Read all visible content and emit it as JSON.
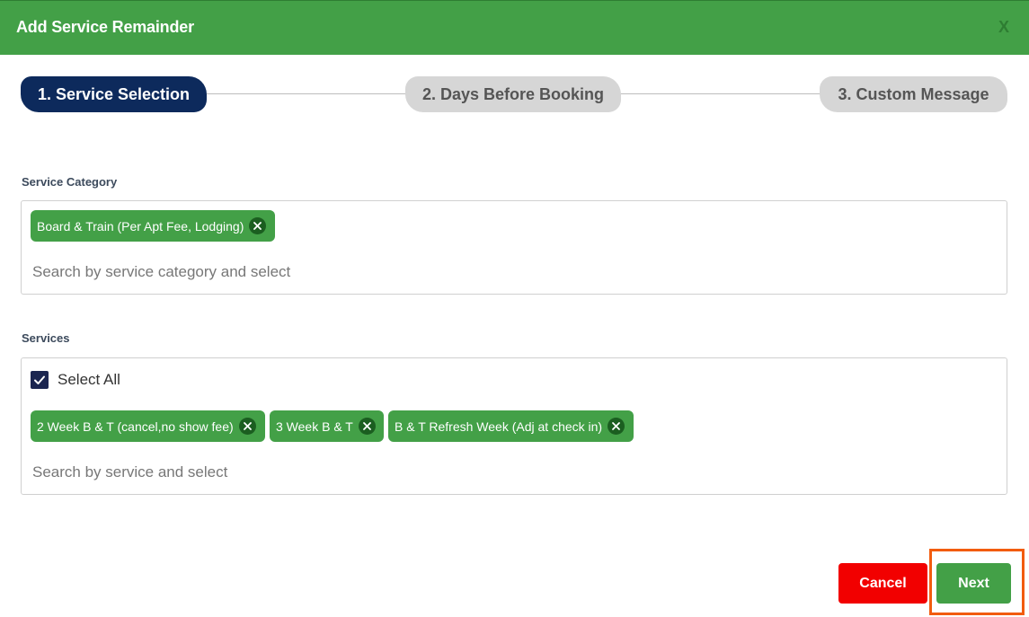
{
  "header": {
    "title": "Add Service Remainder",
    "close_label": "X"
  },
  "steps": [
    {
      "label": "1. Service Selection",
      "active": true
    },
    {
      "label": "2. Days Before Booking",
      "active": false
    },
    {
      "label": "3. Custom Message",
      "active": false
    }
  ],
  "service_category": {
    "label": "Service Category",
    "chips": [
      "Board & Train (Per Apt Fee, Lodging)"
    ],
    "placeholder": "Search by service category and select"
  },
  "services": {
    "label": "Services",
    "select_all_label": "Select All",
    "select_all_checked": true,
    "chips": [
      "2 Week B & T (cancel,no show fee)",
      "3 Week B & T",
      "B & T Refresh Week (Adj at check in)"
    ],
    "placeholder": "Search by service and select"
  },
  "footer": {
    "cancel_label": "Cancel",
    "next_label": "Next"
  },
  "colors": {
    "header_green": "#43a047",
    "chip_green": "#43a047",
    "active_step": "#0d2a5c",
    "inactive_step": "#d6d6d6",
    "cancel_red": "#f20000",
    "highlight_orange": "#f25c0f"
  }
}
